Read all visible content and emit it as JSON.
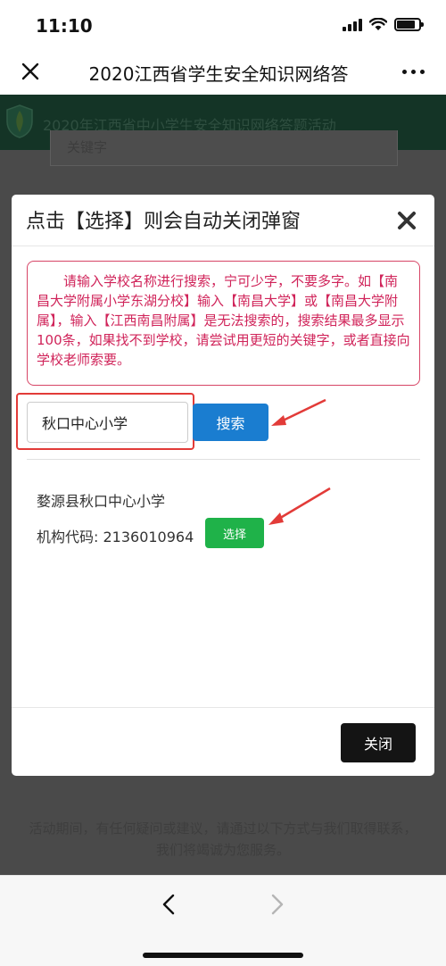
{
  "status_bar": {
    "time": "11:10"
  },
  "nav": {
    "title": "2020江西省学生安全知识网络答"
  },
  "page": {
    "banner_title": "2020年江西省中小学生安全知识网络答题活动",
    "bg_input_text": "关键字",
    "footer_text": "活动期间，有任何疑问或建议，请通过以下方式与我们取得联系，我们将竭诚为您服务。"
  },
  "modal": {
    "title": "点击【选择】则会自动关闭弹窗",
    "notice": "请输入学校名称进行搜索，宁可少字，不要多字。如【南昌大学附属小学东湖分校】输入【南昌大学】或【南昌大学附属】，输入【江西南昌附属】是无法搜索的，搜索结果最多显示100条，如果找不到学校，请尝试用更短的关键字，或者直接向学校老师索要。",
    "search_value": "秋口中心小学",
    "search_button": "搜索",
    "result": {
      "name": "婺源县秋口中心小学",
      "code": "机构代码: 2136010964",
      "select_button": "选择"
    },
    "close_button": "关闭"
  },
  "colors": {
    "notice_red": "#d0245a",
    "search_blue": "#1a7dd0",
    "select_green": "#1fb249",
    "annotation_red": "#e23b38"
  }
}
